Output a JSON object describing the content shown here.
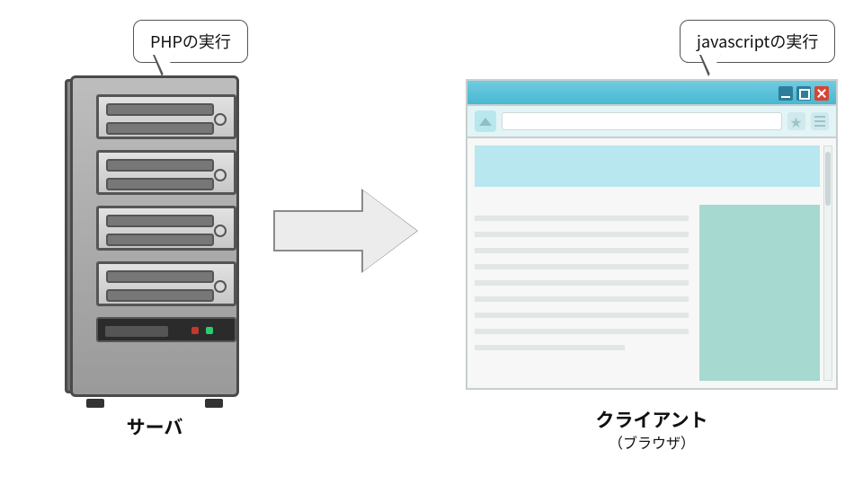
{
  "callouts": {
    "left": "PHPの実行",
    "right": "javascriptの実行"
  },
  "labels": {
    "server": "サーバ",
    "client": "クライアント",
    "client_sub": "（ブラウザ）"
  },
  "icons": {
    "arrow": "arrow-right",
    "home": "home-icon",
    "star": "star-icon",
    "menu": "hamburger-icon",
    "window_minimize": "minimize-icon",
    "window_maximize": "maximize-icon",
    "window_close": "close-icon"
  },
  "colors": {
    "browser_chrome": "#48b8d0",
    "hero_block": "#b8e7f0",
    "aside_block": "#a6d9cf",
    "arrow_fill": "#ececec"
  }
}
